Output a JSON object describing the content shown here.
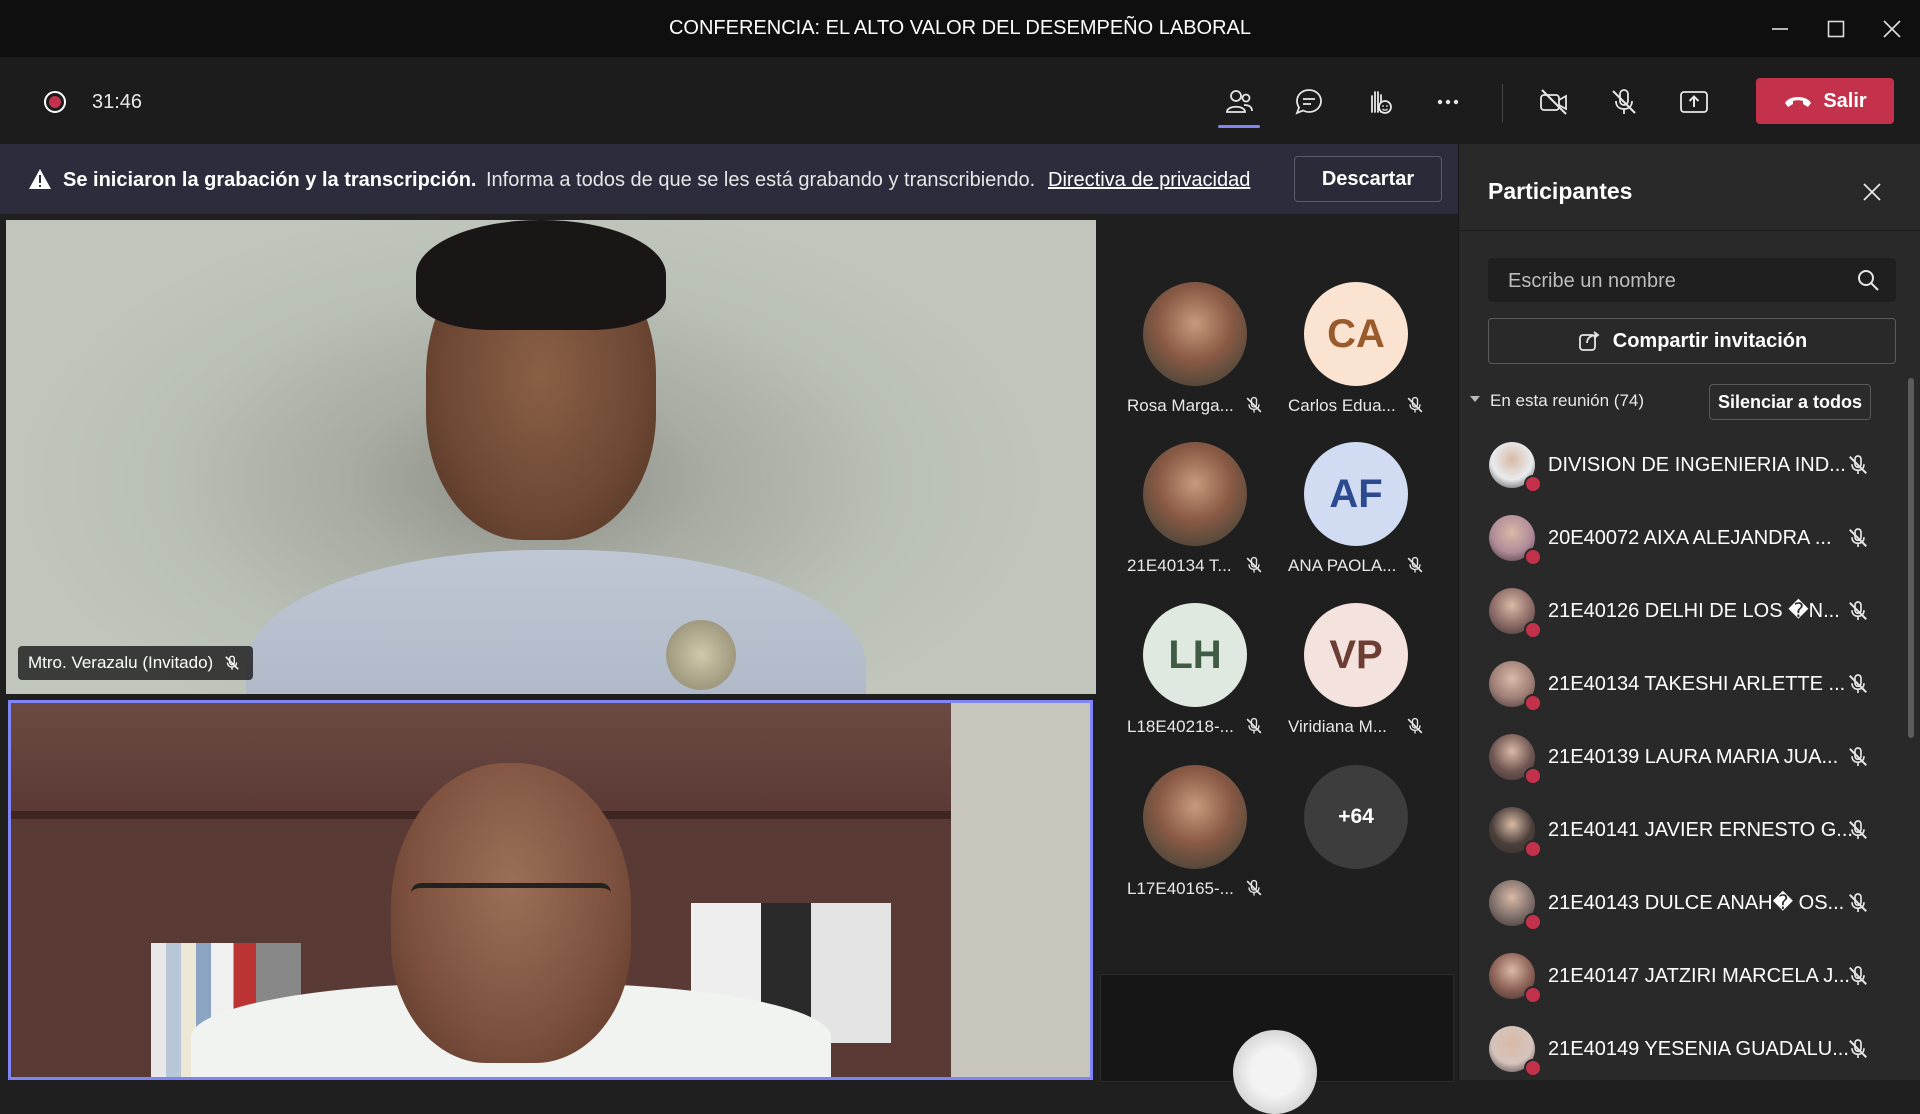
{
  "window": {
    "title": "CONFERENCIA: EL ALTO VALOR DEL DESEMPEÑO LABORAL",
    "controls": [
      "minimize",
      "maximize",
      "close"
    ]
  },
  "toolbar": {
    "timer": "31:46",
    "icons": [
      "people-icon",
      "chat-icon",
      "raise-hand-icon",
      "more-options-icon",
      "camera-off-icon",
      "mic-off-icon",
      "share-screen-icon"
    ],
    "leave_label": "Salir",
    "leave_color": "#c4314b"
  },
  "banner": {
    "bold": "Se iniciaron la grabación y la transcripción.",
    "text": "Informa a todos de que se les está grabando y transcribiendo.",
    "link": "Directiva de privacidad",
    "dismiss": "Descartar"
  },
  "stage": {
    "speaker_label": "Mtro. Verazalu (Invitado)"
  },
  "gallery": [
    {
      "initials": "",
      "name": "Rosa Marga...",
      "photo": true
    },
    {
      "initials": "CA",
      "name": "Carlos Edua...",
      "bg": "#fbe3d1",
      "fg": "#9a5b2c"
    },
    {
      "initials": "",
      "name": "21E40134 T...",
      "photo": true
    },
    {
      "initials": "AF",
      "name": "ANA PAOLA...",
      "bg": "#d1dcf3",
      "fg": "#2c4a8f"
    },
    {
      "initials": "LH",
      "name": "L18E40218-...",
      "bg": "#dfe9e0",
      "fg": "#3f5a45"
    },
    {
      "initials": "VP",
      "name": "Viridiana M...",
      "bg": "#f3e2de",
      "fg": "#6d3e34"
    },
    {
      "initials": "",
      "name": "L17E40165-...",
      "photo": true
    },
    {
      "more": "+64"
    }
  ],
  "panel": {
    "title": "Participantes",
    "search_placeholder": "Escribe un nombre",
    "invite_label": "Compartir invitación",
    "section_label": "En esta reunión (74)",
    "mute_all": "Silenciar a todos",
    "participants": [
      "DIVISION DE INGENIERIA IND...",
      "20E40072 AIXA ALEJANDRA ...",
      "21E40126 DELHI DE LOS �N...",
      "21E40134 TAKESHI ARLETTE ...",
      "21E40139 LAURA MARIA JUA...",
      "21E40141 JAVIER ERNESTO G...",
      "21E40143 DULCE ANAH� OS...",
      "21E40147 JATZIRI MARCELA J...",
      "21E40149 YESENIA GUADALU..."
    ]
  },
  "accent": "#7f85f5"
}
